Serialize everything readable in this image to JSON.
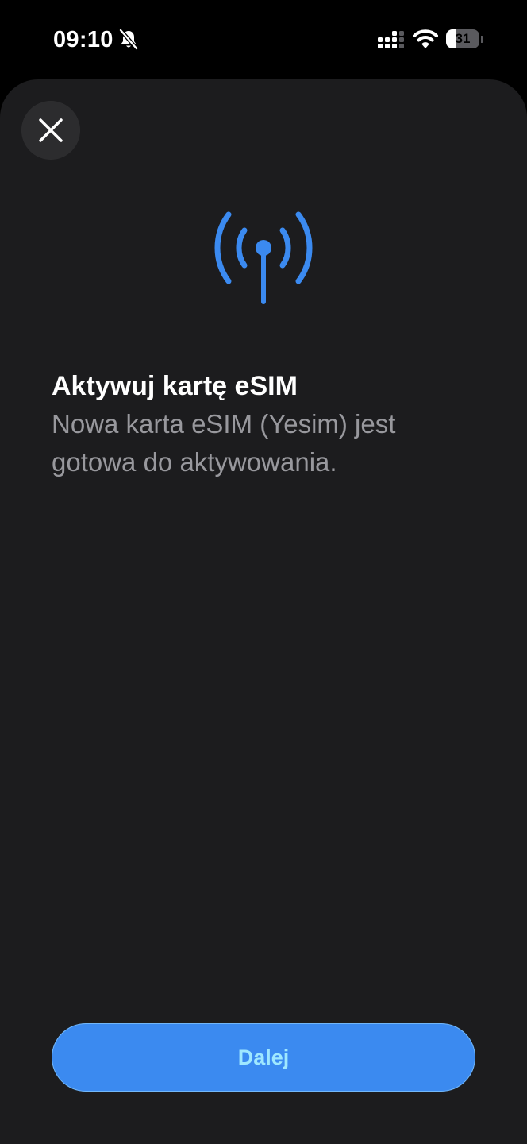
{
  "status_bar": {
    "time": "09:10",
    "battery_level": "31",
    "icons": [
      "bell-slash-icon",
      "cellular-signal-icon",
      "wifi-icon",
      "battery-icon"
    ]
  },
  "sheet": {
    "close_icon": "close-icon",
    "hero_icon": "antenna-icon",
    "title": "Aktywuj kartę eSIM",
    "description": "Nowa karta eSIM (Yesim) jest gotowa do aktywowania.",
    "primary_button_label": "Dalej"
  },
  "colors": {
    "background": "#1c1c1e",
    "accent": "#3b8af0",
    "button_text": "#9fe8ff",
    "secondary_text": "#98989d"
  }
}
